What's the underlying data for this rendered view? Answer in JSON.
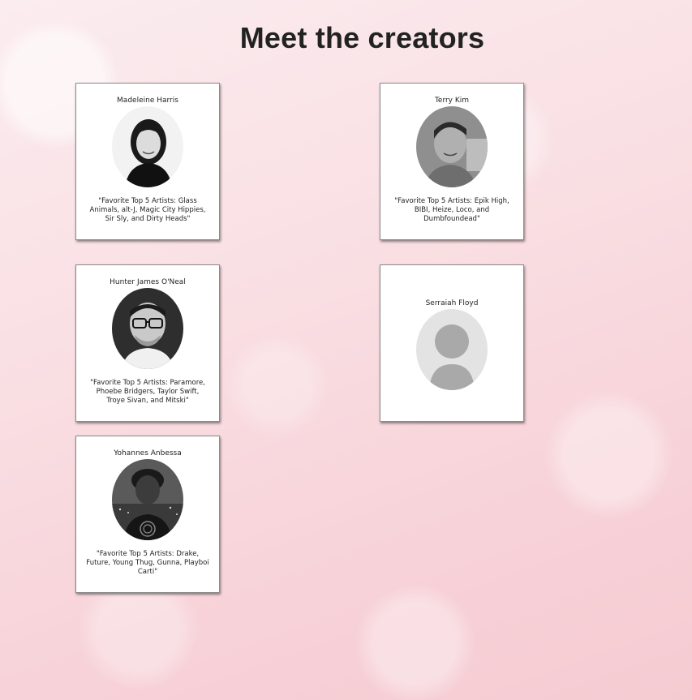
{
  "page": {
    "title": "Meet the creators"
  },
  "creators": [
    {
      "name": "Madeleine Harris",
      "quote": "\"Favorite Top 5 Artists: Glass Animals, alt-J, Magic City Hippies, Sir Sly, and Dirty Heads\"",
      "avatar": "portrait-photo"
    },
    {
      "name": "Terry Kim",
      "quote": "\"Favorite Top 5 Artists: Epik High, BIBI, Heize, Loco, and Dumbfoundead\"",
      "avatar": "portrait-photo"
    },
    {
      "name": "Hunter James O'Neal",
      "quote": "\"Favorite Top 5 Artists: Paramore, Phoebe Bridgers, Taylor Swift, Troye Sivan, and Mitski\"",
      "avatar": "portrait-photo"
    },
    {
      "name": "Serraiah Floyd",
      "quote": "",
      "avatar": "default-avatar-icon"
    },
    {
      "name": "Yohannes Anbessa",
      "quote": "\"Favorite Top 5 Artists: Drake, Future, Young Thug, Gunna, Playboi Carti\"",
      "avatar": "portrait-photo"
    }
  ],
  "colors": {
    "background": "#f8dde2",
    "card": "#ffffff",
    "title": "#222222",
    "placeholder_bg": "#e3e3e3",
    "placeholder_figure": "#a9a9a9"
  }
}
